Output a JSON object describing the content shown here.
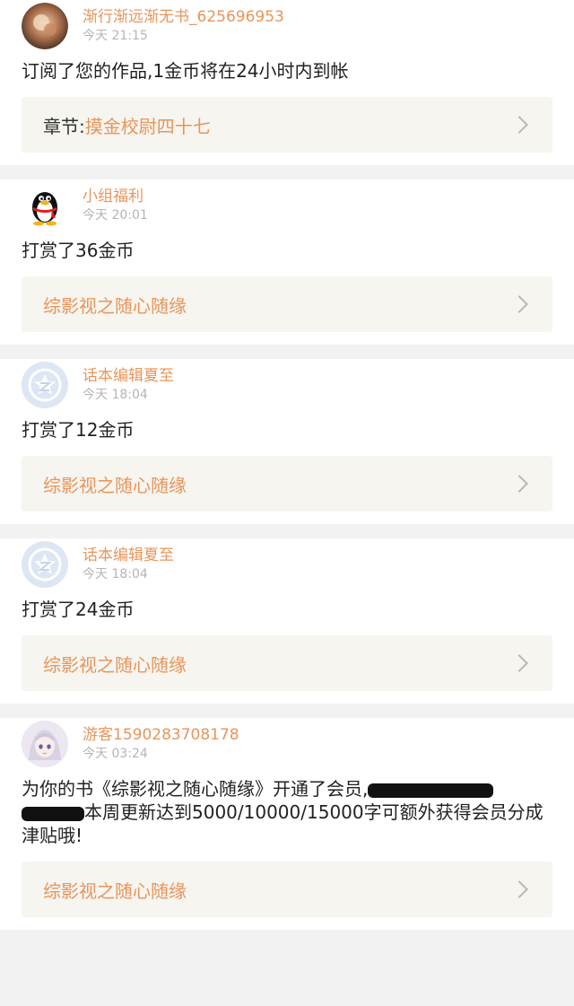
{
  "notifications": [
    {
      "avatar_type": "photo-flower",
      "user": "渐行渐远渐无书_625696953",
      "time": "今天 21:15",
      "message": "订阅了您的作品,1金币将在24小时内到帐",
      "link_prefix": "章节:",
      "link_label": "摸金校尉四十七"
    },
    {
      "avatar_type": "penguin-icon",
      "user": "小组福利",
      "time": "今天 20:01",
      "message": "打赏了36金币",
      "link_prefix": "",
      "link_label": "综影视之随心随缘"
    },
    {
      "avatar_type": "star-badge-icon",
      "user": "话本编辑夏至",
      "time": "今天 18:04",
      "message": "打赏了12金币",
      "link_prefix": "",
      "link_label": "综影视之随心随缘"
    },
    {
      "avatar_type": "star-badge-icon",
      "user": "话本编辑夏至",
      "time": "今天 18:04",
      "message": "打赏了24金币",
      "link_prefix": "",
      "link_label": "综影视之随心随缘"
    },
    {
      "avatar_type": "anime-girl-avatar",
      "user": "游客1590283708178",
      "time": "今天 03:24",
      "message_part1": "为你的书《综影视之随心随缘》开通了会员,",
      "message_part2": "本周更新达到5000/10000/15000字可额外获得会员分成津贴哦!",
      "link_prefix": "",
      "link_label": "综影视之随心随缘"
    }
  ],
  "colors": {
    "accent": "#e8955a",
    "link_bg": "#f6f5f0",
    "time_gray": "#b5b5b5",
    "page_bg": "#f2f2f2"
  }
}
